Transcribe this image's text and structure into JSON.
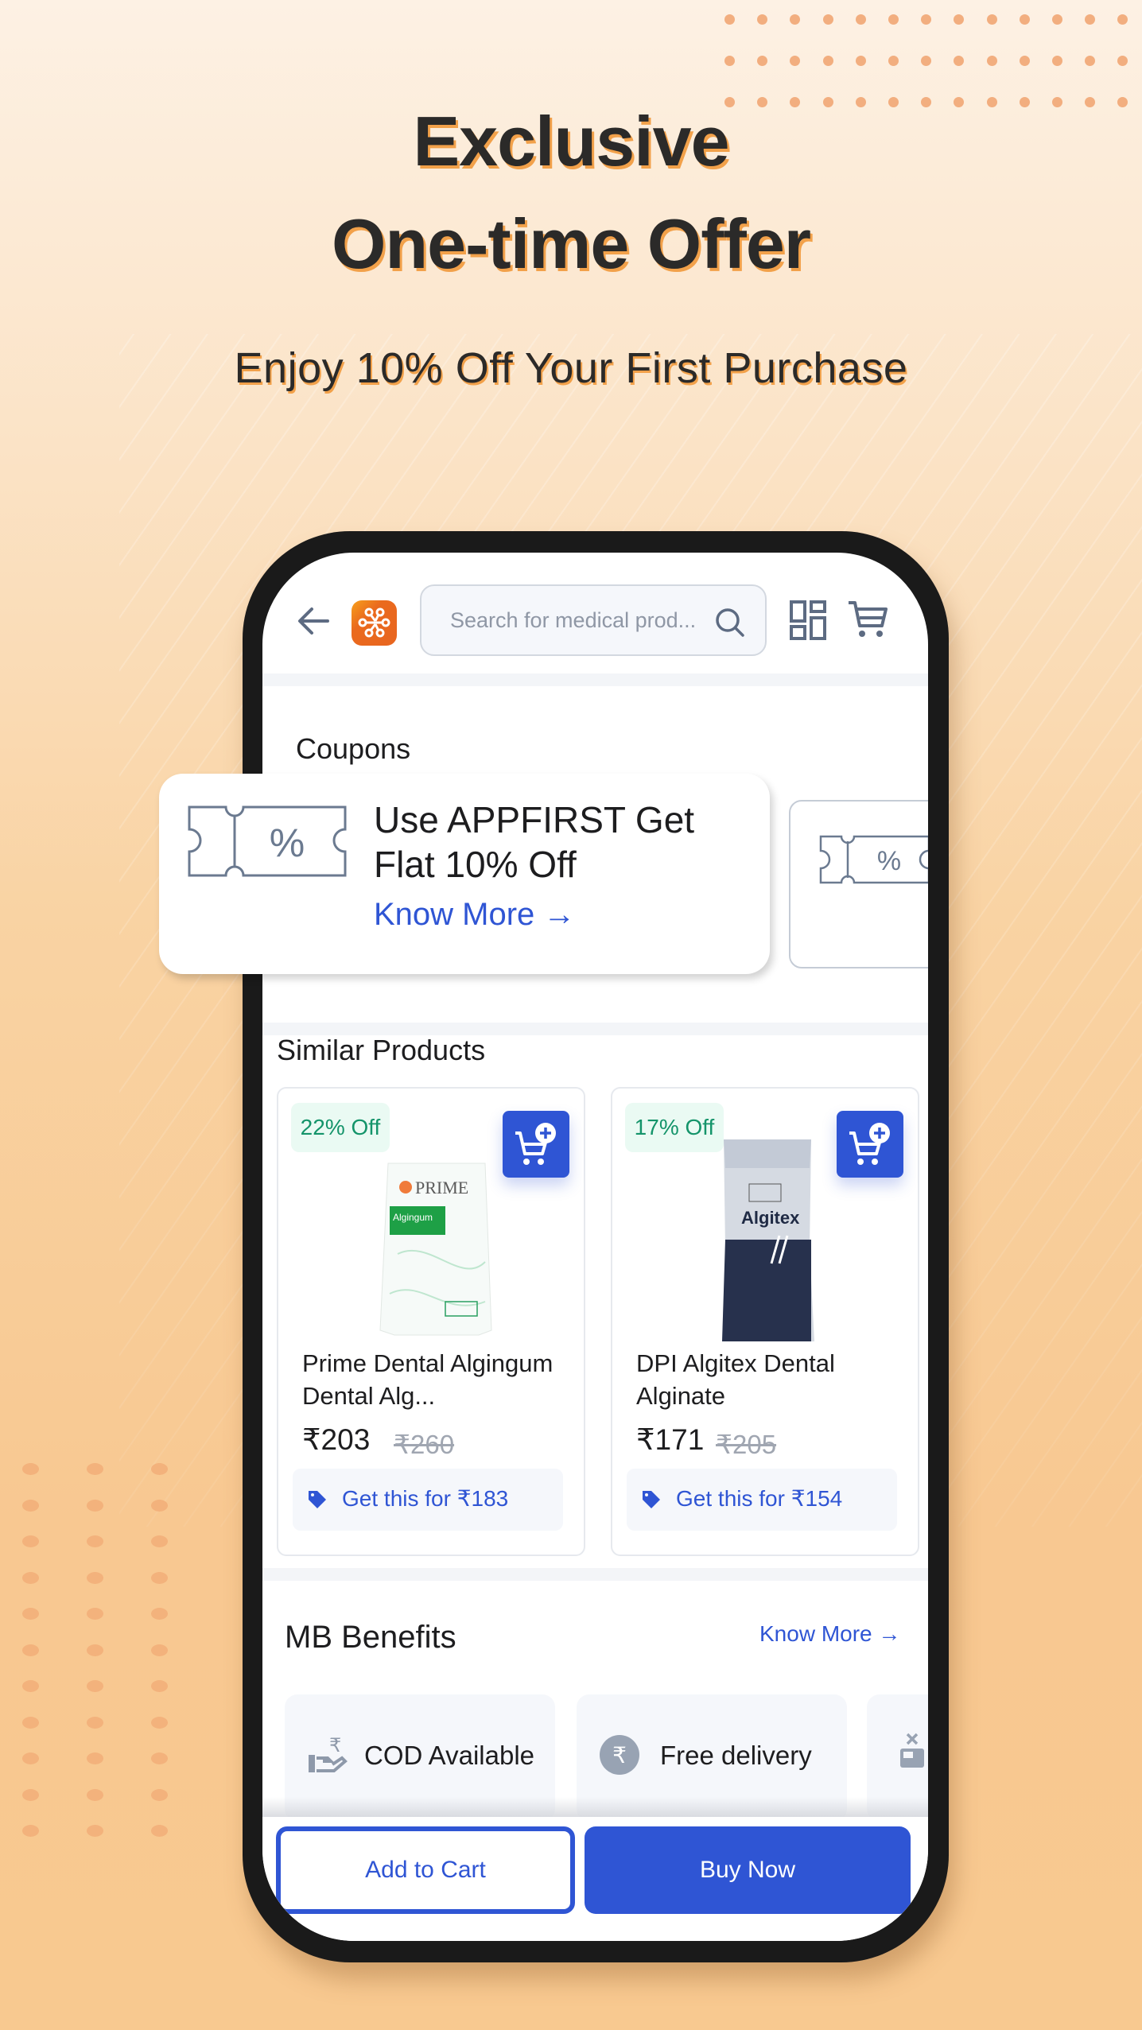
{
  "banner": {
    "headline_line1": "Exclusive",
    "headline_line2": "One-time Offer",
    "subheadline": "Enjoy 10% Off Your First Purchase"
  },
  "header": {
    "back_icon": "arrow-left-icon",
    "logo_icon": "app-logo-icon",
    "search_placeholder": "Search for medical prod...",
    "search_icon": "search-icon",
    "qr_icon": "qr-scan-icon",
    "cart_icon": "cart-icon"
  },
  "coupons": {
    "title": "Coupons",
    "items": [
      {
        "icon": "coupon-ticket-icon",
        "text": "Use APPFIRST Get Flat 10% Off",
        "link": "Know More →"
      },
      {
        "icon": "coupon-ticket-icon",
        "text": "",
        "link": ""
      }
    ]
  },
  "similar_products": {
    "title": "Similar Products",
    "items": [
      {
        "discount": "22% Off",
        "name": "Prime Dental Algingum Dental Alg...",
        "price": "₹203",
        "mrp": "₹260",
        "offer": "Get this for ₹183",
        "image_label": "PRIME Algingum"
      },
      {
        "discount": "17% Off",
        "name": "DPI Algitex Dental Alginate",
        "price": "₹171",
        "mrp": "₹205",
        "offer": "Get this for ₹154",
        "image_label": "Algitex"
      }
    ]
  },
  "benefits": {
    "title": "MB Benefits",
    "link": "Know More →",
    "items": [
      {
        "icon": "cash-hand-icon",
        "label": "COD Available"
      },
      {
        "icon": "rupee-circle-icon",
        "label": "Free delivery"
      },
      {
        "icon": "no-return-box-icon",
        "label": ""
      }
    ]
  },
  "actions": {
    "add_to_cart": "Add to Cart",
    "buy_now": "Buy Now"
  },
  "colors": {
    "primary": "#2f55d4",
    "discount_green": "#14946a",
    "brand_orange": "#ea6a1e",
    "headline_shadow": "#f2a14a"
  }
}
